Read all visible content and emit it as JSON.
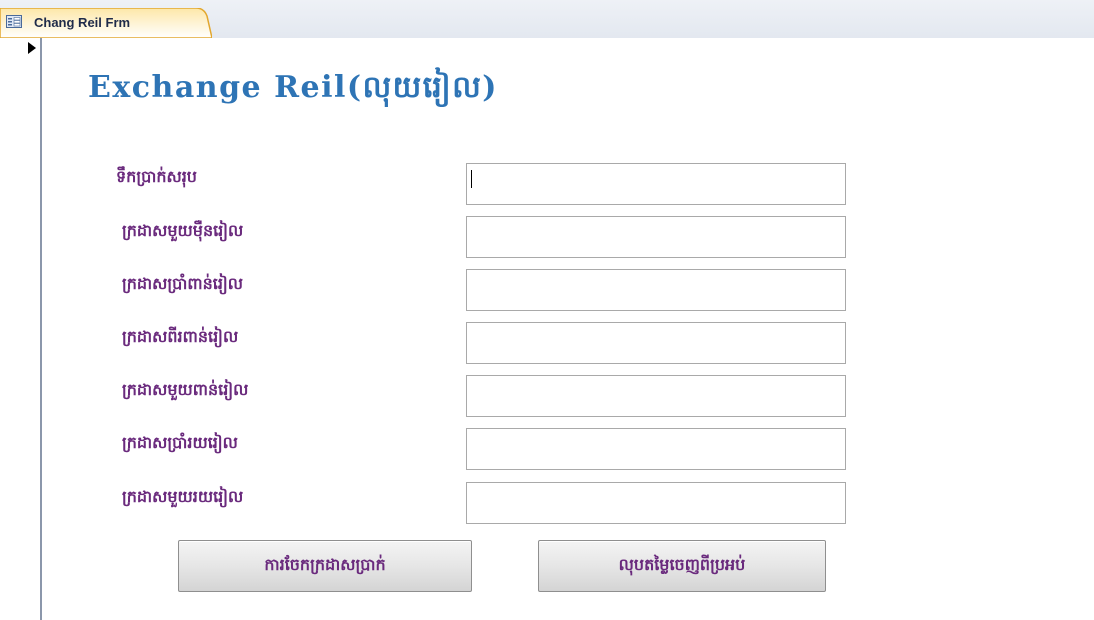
{
  "tab": {
    "title": "Chang Reil Frm",
    "icon": "form-icon"
  },
  "form": {
    "title": "Exchange Reil(លុយរៀល)",
    "fields": [
      {
        "label": "ទឹកប្រាក់សរុប",
        "value": ""
      },
      {
        "label": "ក្រដាសមួយម៉ឺនរៀល",
        "value": ""
      },
      {
        "label": "ក្រដាសប្រាំពាន់រៀល",
        "value": ""
      },
      {
        "label": "ក្រដាសពីរពាន់រៀល",
        "value": ""
      },
      {
        "label": "ក្រដាសមួយពាន់រៀល",
        "value": ""
      },
      {
        "label": "ក្រដាសប្រាំរយរៀល",
        "value": ""
      },
      {
        "label": "ក្រដាសមួយរយរៀល",
        "value": ""
      }
    ],
    "buttons": {
      "calculate": "ការចែកក្រដាសប្រាក់",
      "clear": "លុបតម្លៃចេញពីប្រអប់"
    }
  },
  "colors": {
    "title": "#2e74b5",
    "label": "#6a2a7d",
    "tab_accent": "#f5b335"
  }
}
